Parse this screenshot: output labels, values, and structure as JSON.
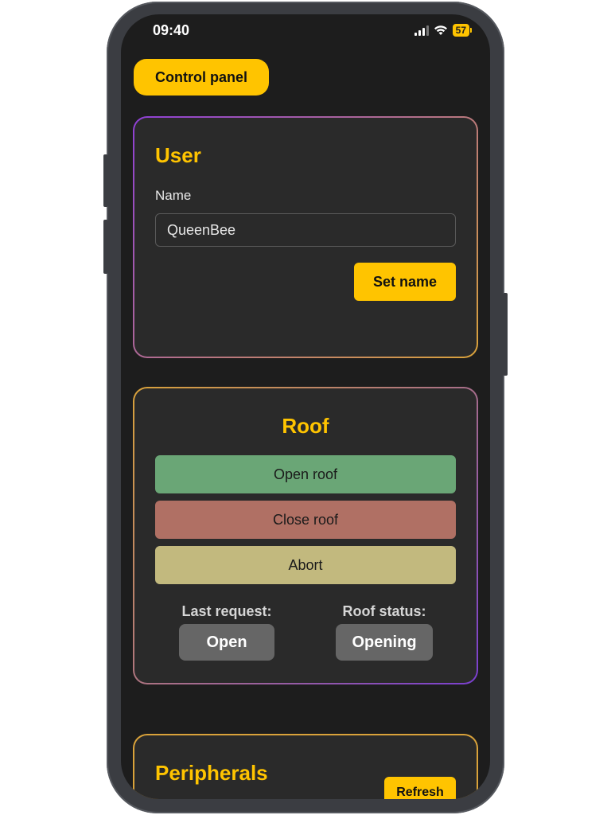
{
  "status_bar": {
    "time": "09:40",
    "battery": "57",
    "icons": [
      "signal-icon",
      "wifi-icon",
      "battery-icon"
    ]
  },
  "header": {
    "control_panel_label": "Control panel"
  },
  "user_card": {
    "title": "User",
    "name_label": "Name",
    "name_value": "QueenBee",
    "set_name_label": "Set name"
  },
  "roof_card": {
    "title": "Roof",
    "open_label": "Open roof",
    "close_label": "Close roof",
    "abort_label": "Abort",
    "last_request_label": "Last request:",
    "last_request_value": "Open",
    "roof_status_label": "Roof status:",
    "roof_status_value": "Opening"
  },
  "peripherals_card": {
    "title": "Peripherals",
    "refresh_label": "Refresh"
  },
  "colors": {
    "accent": "#ffc400",
    "open_button": "#6aa676",
    "close_button": "#b07064",
    "abort_button": "#c2b97e",
    "card_bg": "#2a2a2a",
    "screen_bg": "#1d1d1d"
  }
}
